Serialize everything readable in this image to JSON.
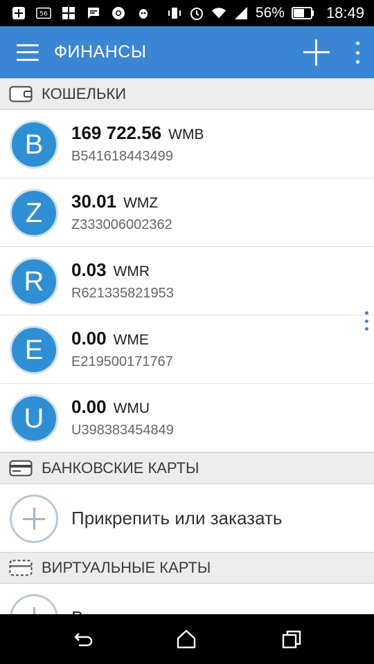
{
  "status_bar": {
    "battery_percent": "56%",
    "time": "18:49",
    "icons": [
      "add-box-icon",
      "hd-icon",
      "grid-icon",
      "message-icon",
      "chrome-icon",
      "bug-icon",
      "vibrate-icon",
      "alarm-icon",
      "wifi-icon",
      "signal-icon",
      "battery-icon"
    ]
  },
  "app_bar": {
    "title": "ФИНАНСЫ",
    "menu_icon": "hamburger-menu-icon",
    "add_icon": "plus-icon",
    "overflow_icon": "more-vertical-icon"
  },
  "sections": {
    "wallets": {
      "label": "КОШЕЛЬКИ",
      "icon": "wallet-icon"
    },
    "bank_cards": {
      "label": "БАНКОВСКИЕ КАРТЫ",
      "icon": "credit-card-icon"
    },
    "virtual_cards": {
      "label": "ВИРТУАЛЬНЫЕ КАРТЫ",
      "icon": "virtual-card-icon"
    }
  },
  "wallets": [
    {
      "letter": "B",
      "amount": "169 722.56",
      "currency": "WMB",
      "id": "B541618443499"
    },
    {
      "letter": "Z",
      "amount": "30.01",
      "currency": "WMZ",
      "id": "Z333006002362"
    },
    {
      "letter": "R",
      "amount": "0.03",
      "currency": "WMR",
      "id": "R621335821953"
    },
    {
      "letter": "E",
      "amount": "0.00",
      "currency": "WME",
      "id": "E219500171767"
    },
    {
      "letter": "U",
      "amount": "0.00",
      "currency": "WMU",
      "id": "U398383454849"
    }
  ],
  "bank_cards": {
    "add_label": "Прикрепить или заказать"
  },
  "virtual_cards": {
    "partial_label": "В"
  },
  "nav_bar": {
    "back_icon": "back-icon",
    "home_icon": "home-icon",
    "recents_icon": "recents-icon"
  },
  "colors": {
    "app_bar": "#3b86d4",
    "avatar": "#2f8fd4",
    "section_bg": "#ececec"
  }
}
